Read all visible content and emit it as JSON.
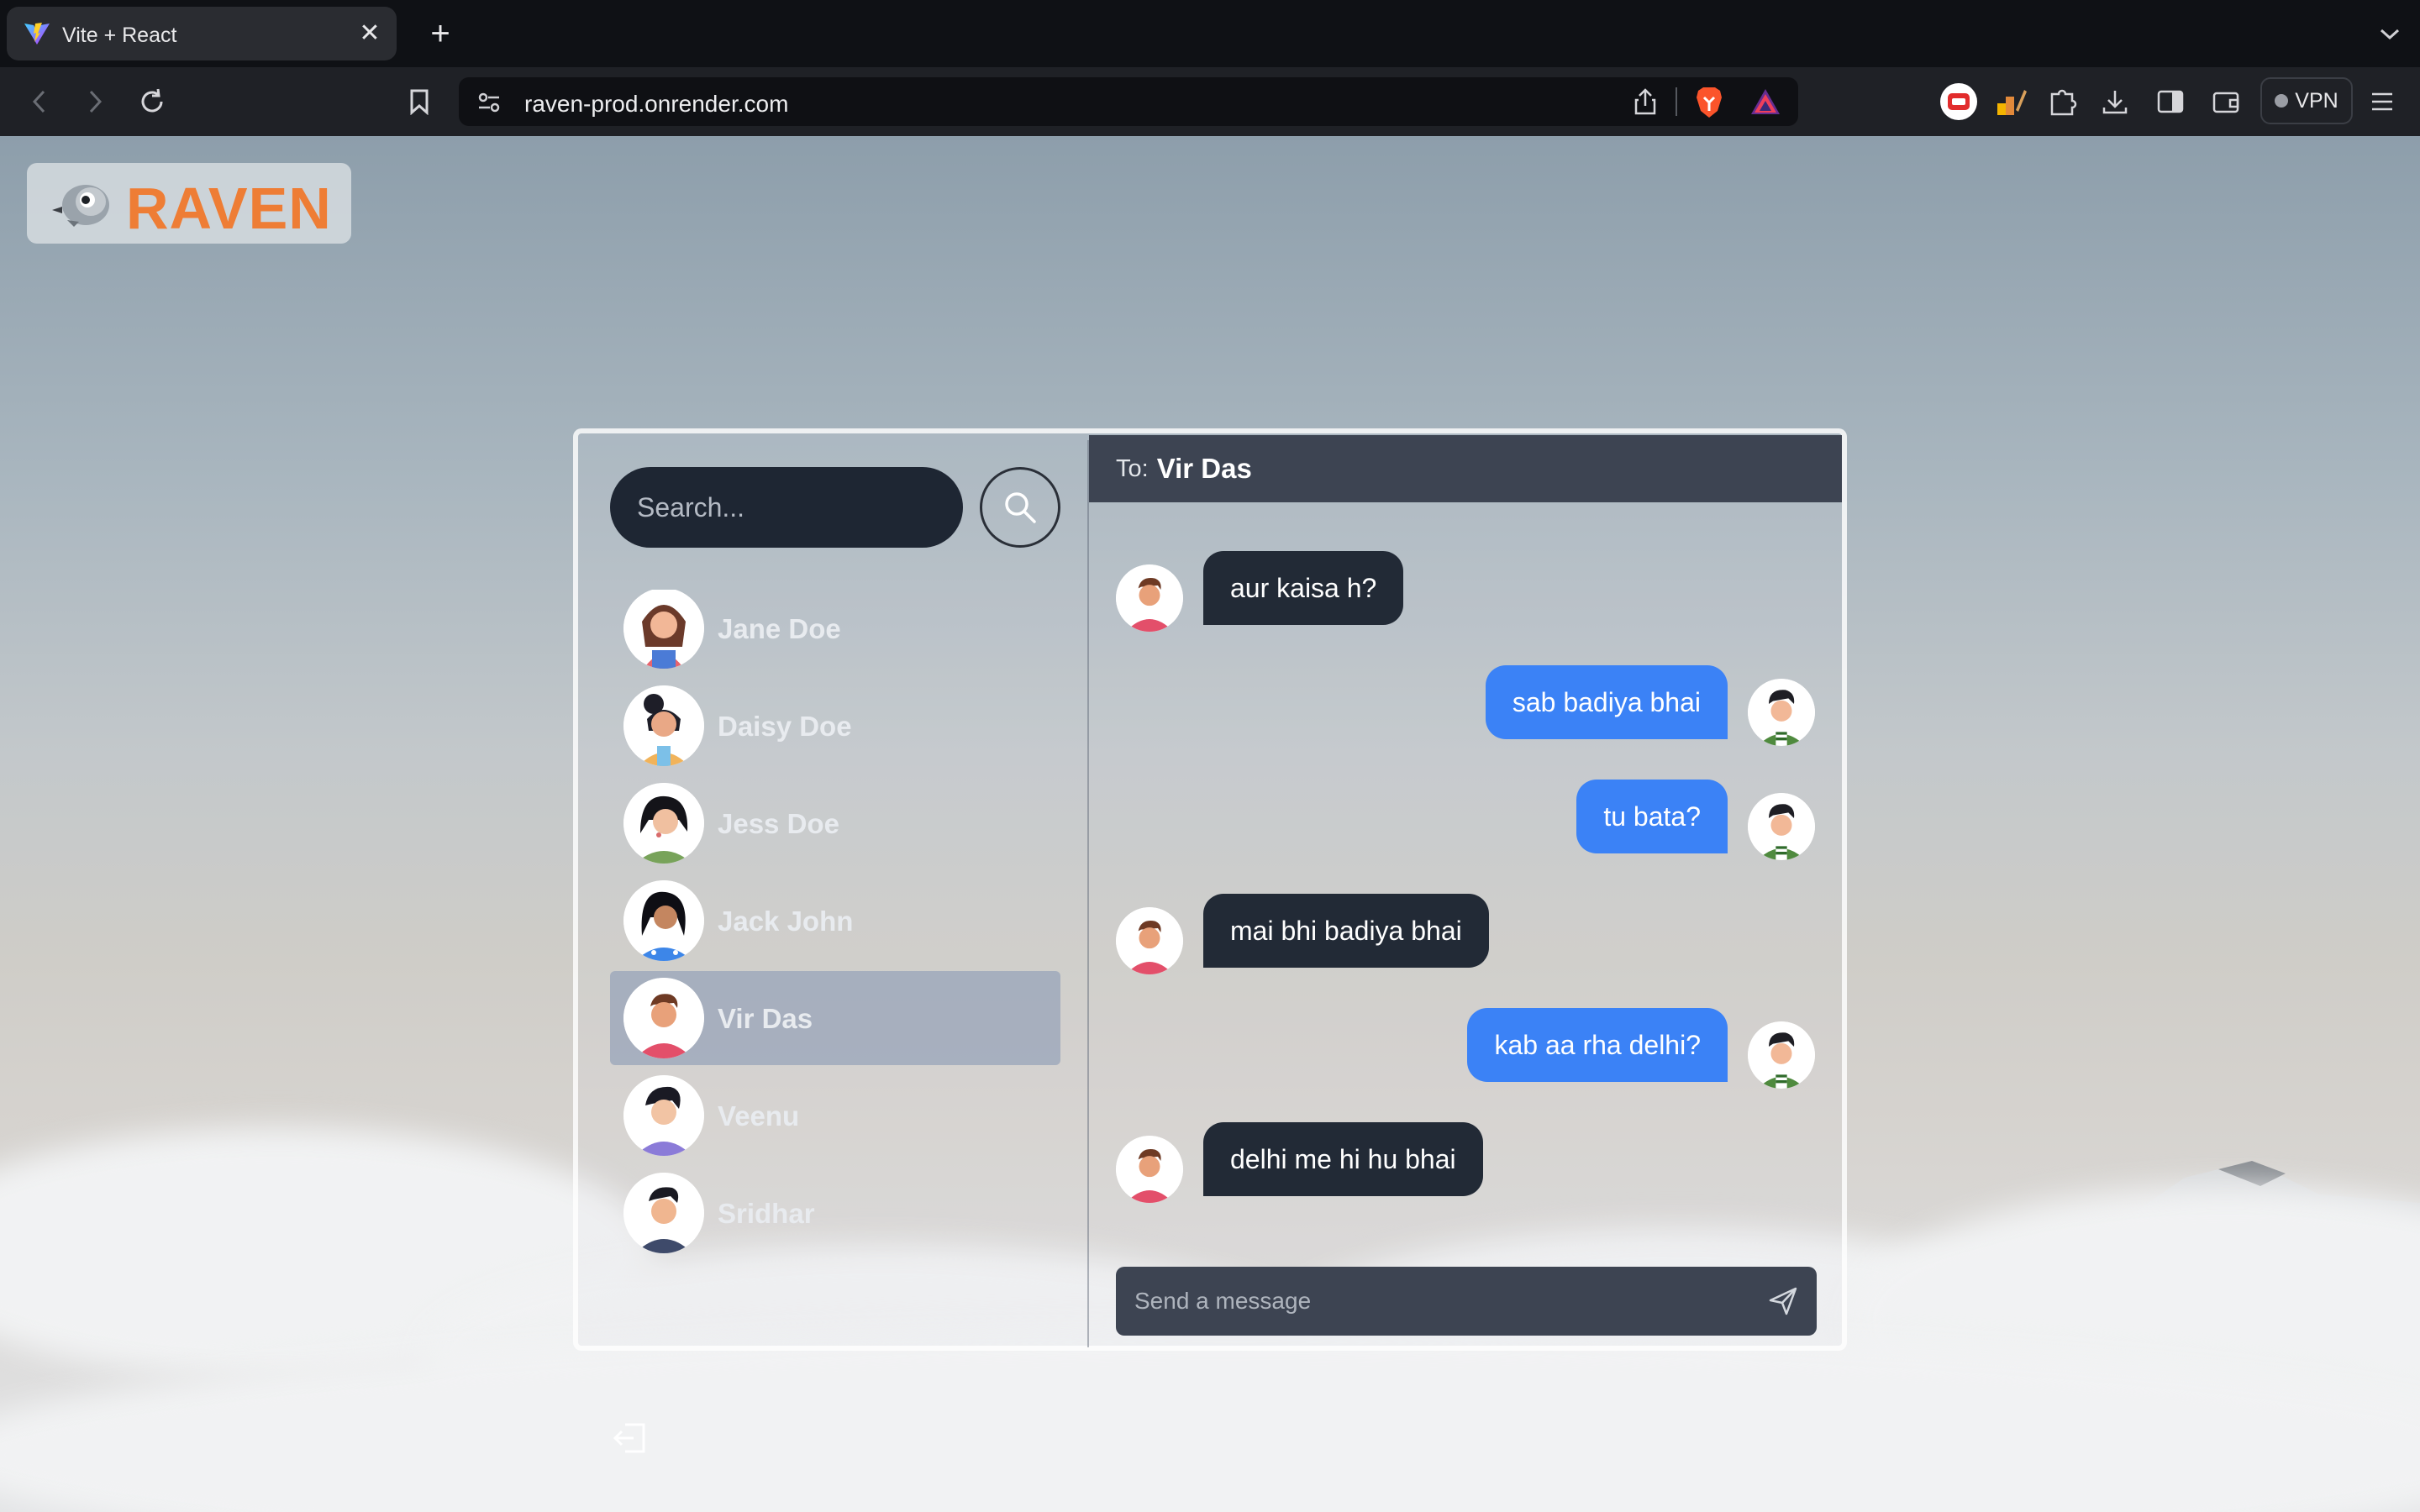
{
  "browser": {
    "tab_title": "Vite + React",
    "tab_close": "✕",
    "new_tab": "+",
    "url": "raven-prod.onrender.com",
    "vpn_label": "VPN"
  },
  "app": {
    "logo_text": "RAVEN",
    "accent_color": "#ee7d35",
    "search_placeholder": "Search...",
    "contacts": [
      {
        "name": "Jane Doe",
        "active": false
      },
      {
        "name": "Daisy Doe",
        "active": false
      },
      {
        "name": "Jess Doe",
        "active": false
      },
      {
        "name": "Jack John",
        "active": false
      },
      {
        "name": "Vir Das",
        "active": true
      },
      {
        "name": "Veenu",
        "active": false
      },
      {
        "name": "Sridhar",
        "active": false
      }
    ],
    "chat": {
      "to_label": "To:",
      "to_name": "Vir Das",
      "messages": [
        {
          "text": "aur kaisa h?",
          "from": "them"
        },
        {
          "text": "sab badiya bhai",
          "from": "me"
        },
        {
          "text": "tu bata?",
          "from": "me"
        },
        {
          "text": "mai bhi badiya bhai",
          "from": "them"
        },
        {
          "text": "kab aa rha delhi?",
          "from": "me"
        },
        {
          "text": "delhi me hi hu bhai",
          "from": "them"
        }
      ],
      "message_placeholder": "Send a message",
      "outgoing_color": "#3b82f6",
      "incoming_color": "#222a36"
    }
  }
}
